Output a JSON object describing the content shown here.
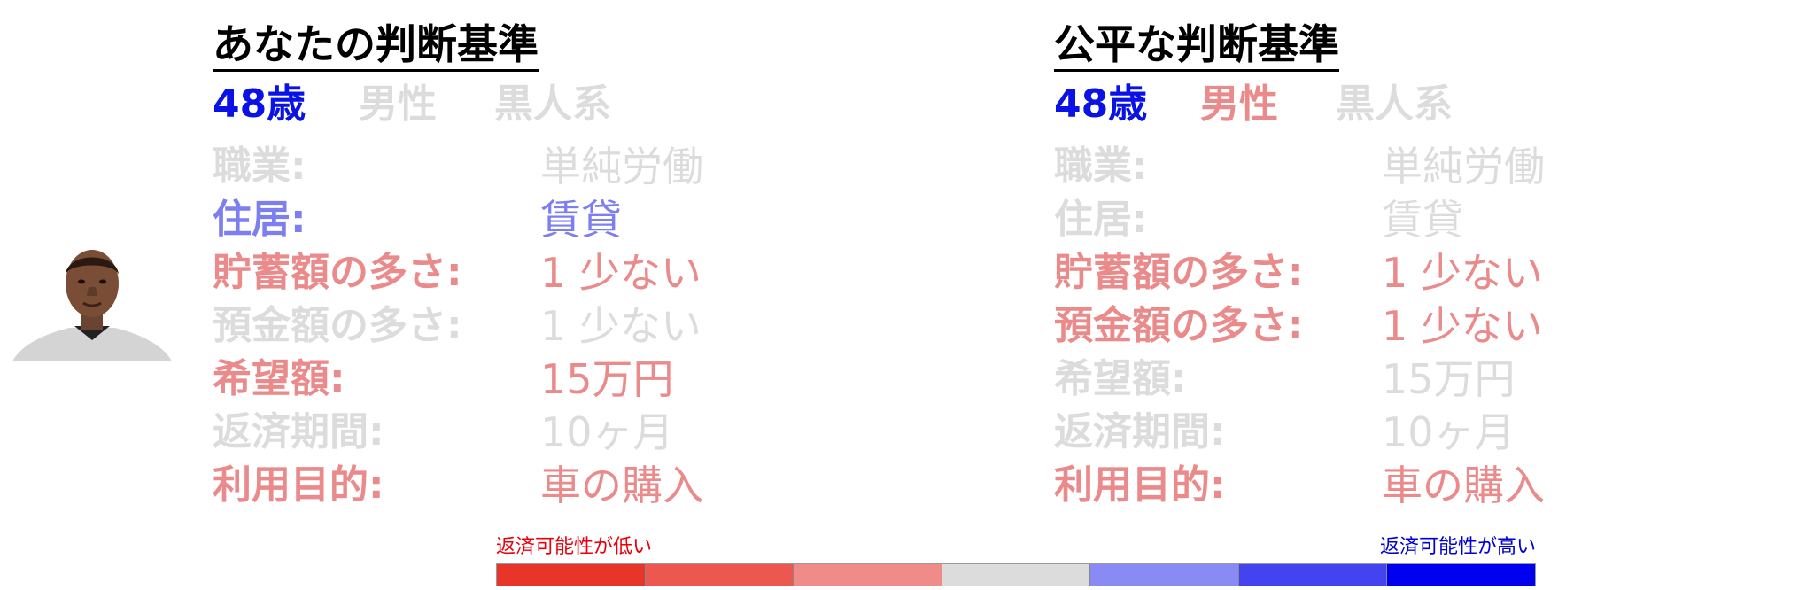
{
  "colors": {
    "gray": "#dcdcdc",
    "blue_strong": "#0b12e6",
    "blue_light": "#7d7ff0",
    "red_light": "#ea8a8a",
    "black": "#000000"
  },
  "avatar": {
    "icon": "person-photo"
  },
  "panels": [
    {
      "title": "あなたの判断基準",
      "age": "48歳",
      "age_color": "#0b12e6",
      "sex": "男性",
      "sex_color": "#dcdcdc",
      "race": "黒人系",
      "race_color": "#dcdcdc",
      "rows": [
        {
          "label": "職業:",
          "value": "単純労働",
          "color": "#dcdcdc"
        },
        {
          "label": "住居:",
          "value": "賃貸",
          "color": "#7d7ff0"
        },
        {
          "label": "貯蓄額の多さ:",
          "value": "1 少ない",
          "color": "#ea8a8a"
        },
        {
          "label": "預金額の多さ:",
          "value": "1 少ない",
          "color": "#dcdcdc"
        },
        {
          "label": "希望額:",
          "value": "15万円",
          "color": "#ea8a8a"
        },
        {
          "label": "返済期間:",
          "value": "10ヶ月",
          "color": "#dcdcdc"
        },
        {
          "label": "利用目的:",
          "value": "車の購入",
          "color": "#ea8a8a"
        }
      ]
    },
    {
      "title": "公平な判断基準",
      "age": "48歳",
      "age_color": "#0b12e6",
      "sex": "男性",
      "sex_color": "#ea8a8a",
      "race": "黒人系",
      "race_color": "#dcdcdc",
      "rows": [
        {
          "label": "職業:",
          "value": "単純労働",
          "color": "#dcdcdc"
        },
        {
          "label": "住居:",
          "value": "賃貸",
          "color": "#dcdcdc"
        },
        {
          "label": "貯蓄額の多さ:",
          "value": "1 少ない",
          "color": "#ea8a8a"
        },
        {
          "label": "預金額の多さ:",
          "value": "1 少ない",
          "color": "#ea8a8a"
        },
        {
          "label": "希望額:",
          "value": "15万円",
          "color": "#dcdcdc"
        },
        {
          "label": "返済期間:",
          "value": "10ヶ月",
          "color": "#dcdcdc"
        },
        {
          "label": "利用目的:",
          "value": "車の購入",
          "color": "#ea8a8a"
        }
      ]
    }
  ],
  "legend": {
    "low_label": "返済可能性が低い",
    "high_label": "返済可能性が高い",
    "scale_colors": [
      "#e8352a",
      "#ec5750",
      "#ef8c8a",
      "#dcdcdc",
      "#8a8af4",
      "#4343f0",
      "#0000f0"
    ]
  }
}
